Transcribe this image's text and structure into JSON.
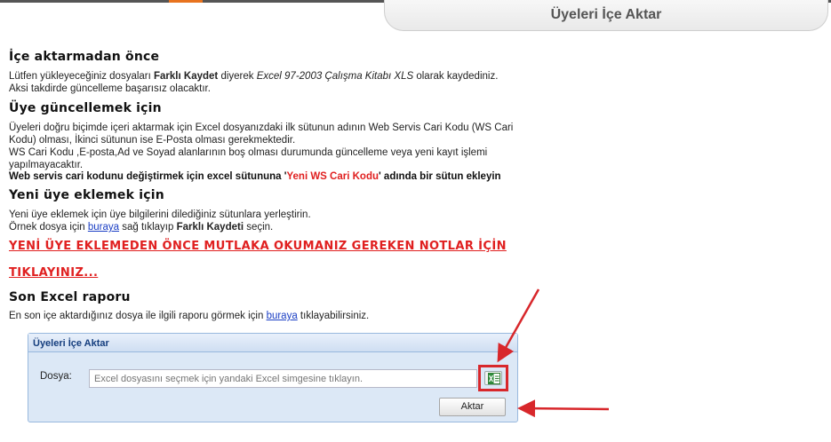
{
  "window": {
    "title": "Üyeleri İçe Aktar"
  },
  "section_before_import": {
    "heading": "İçe aktarmadan önce",
    "text_1": "Lütfen yükleyeceğiniz dosyaları ",
    "bold_1": "Farklı Kaydet",
    "text_2": " diyerek ",
    "italic_1": "Excel 97-2003 Çalışma Kitabı XLS",
    "text_3": " olarak kaydediniz. Aksi takdirde güncelleme başarısız olacaktır."
  },
  "section_update": {
    "heading": "Üye güncellemek için",
    "para_1": "Üyeleri doğru biçimde içeri aktarmak için Excel dosyanızdaki ilk sütunun adının Web Servis Cari Kodu (WS Cari Kodu) olması, İkinci sütunun ise E-Posta olması gerekmektedir.",
    "para_2": "WS Cari Kodu ,E-posta,Ad ve Soyad alanlarının boş olması durumunda güncelleme veya yeni kayıt işlemi yapılmayacaktır.",
    "para_3_a": "Web servis cari kodunu değiştirmek için excel sütununa '",
    "para_3_red": "Yeni WS Cari Kodu",
    "para_3_b": "' adında bir sütun ekleyin"
  },
  "section_new_member": {
    "heading": "Yeni üye eklemek için",
    "para_1": "Yeni üye eklemek için üye bilgilerini dilediğiniz sütunlara yerleştirin.",
    "para_2_a": "Örnek dosya için ",
    "para_2_link": "buraya",
    "para_2_b": " sağ tıklayıp ",
    "para_2_bold": "Farklı Kaydeti",
    "para_2_c": " seçin."
  },
  "warning_link": {
    "line_1": "YENİ ÜYE EKLEMEDEN ÖNCE MUTLAKA OKUMANIZ GEREKEN NOTLAR İÇİN",
    "line_2": "TIKLAYINIZ..."
  },
  "section_report": {
    "heading": "Son Excel raporu",
    "text_a": "En son içe aktardığınız dosya ile ilgili raporu görmek için ",
    "link": "buraya",
    "text_b": " tıklayabilirsiniz."
  },
  "import_panel": {
    "title": "Üyeleri İçe Aktar",
    "file_label": "Dosya:",
    "file_placeholder": "Excel dosyasını seçmek için yandaki Excel simgesine tıklayın.",
    "file_value": "",
    "import_button": "Aktar"
  },
  "colors": {
    "accent_orange": "#e8731e",
    "warning_red": "#e02020",
    "link_blue": "#1a3ec4",
    "panel_bg": "#dce8f6",
    "panel_title": "#153e7e",
    "annotation_red": "#d8272b"
  },
  "icons": {
    "excel_button": "excel-file-icon"
  }
}
